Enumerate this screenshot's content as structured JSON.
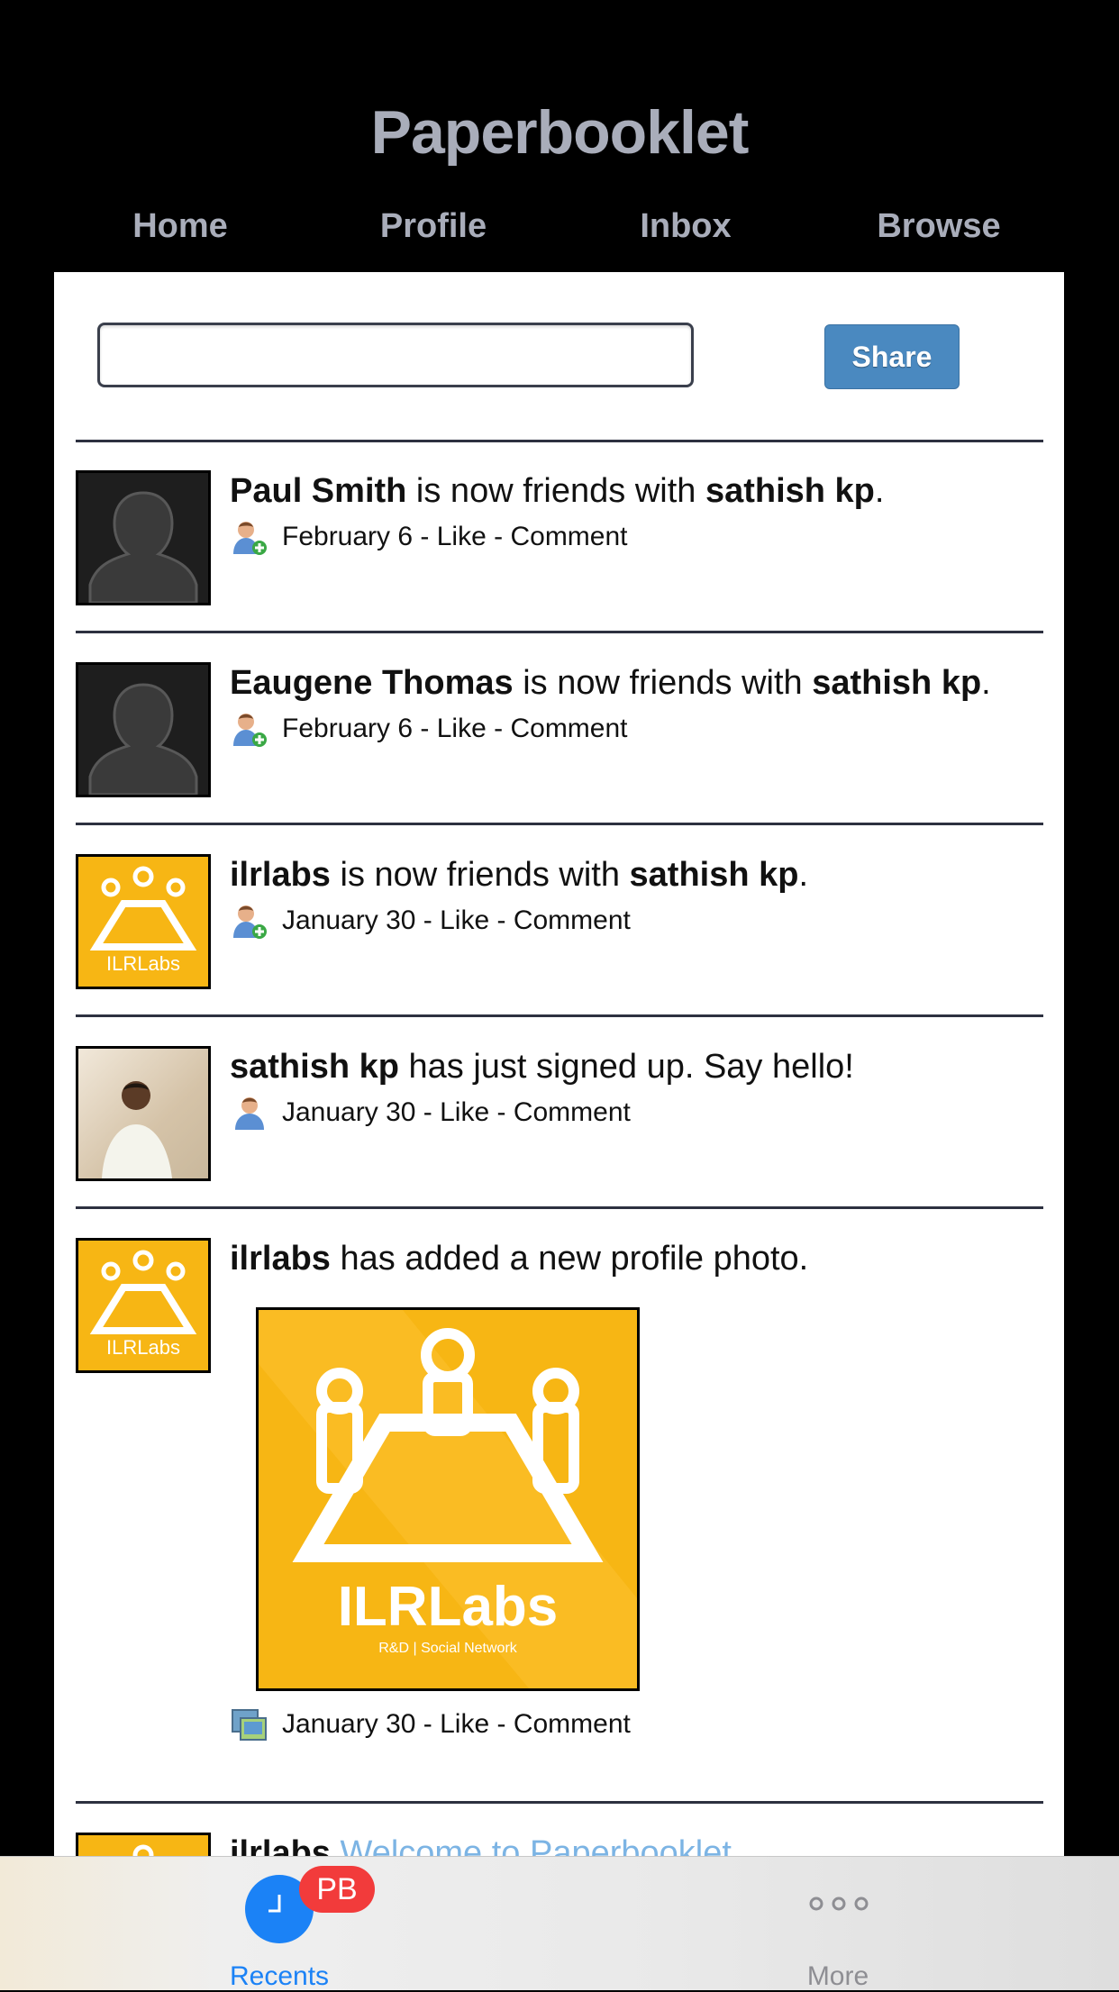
{
  "app": {
    "title": "Paperbooklet"
  },
  "nav": {
    "items": [
      "Home",
      "Profile",
      "Inbox",
      "Browse"
    ]
  },
  "composer": {
    "input_value": "",
    "share_label": "Share"
  },
  "feed": [
    {
      "actor": "Paul Smith",
      "text": " is now friends with ",
      "target": "sathish kp",
      "end": ".",
      "date": "February 6",
      "like": "Like",
      "comment": "Comment",
      "avatar": "silhouette",
      "icon": "add-friend-icon"
    },
    {
      "actor": "Eaugene Thomas",
      "text": " is now friends with ",
      "target": "sathish kp",
      "end": ".",
      "date": "February 6",
      "like": "Like",
      "comment": "Comment",
      "avatar": "silhouette",
      "icon": "add-friend-icon"
    },
    {
      "actor": "ilrlabs",
      "text": " is now friends with ",
      "target": "sathish kp",
      "end": ".",
      "date": "January 30",
      "like": "Like",
      "comment": "Comment",
      "avatar": "ilrlabs-logo",
      "icon": "add-friend-icon"
    },
    {
      "actor": "sathish kp",
      "text": " has just signed up. Say hello!",
      "date": "January 30",
      "like": "Like",
      "comment": "Comment",
      "avatar": "user-photo",
      "icon": "user-icon"
    },
    {
      "actor": "ilrlabs",
      "text": " has added a new profile photo.",
      "date": "January 30",
      "like": "Like",
      "comment": "Comment",
      "avatar": "ilrlabs-logo",
      "icon": "photos-icon",
      "photo_logo": "ILRLabs",
      "photo_sub": "R&D | Social Network"
    },
    {
      "actor": "ilrlabs",
      "link": "Welcome to Paperbooklet",
      "avatar": "ilrlabs-logo"
    }
  ],
  "meta_separator": " - ",
  "logo_small": {
    "name": "ILRLabs",
    "sub": "R&D | Social Network"
  },
  "tabbar": {
    "recents_label": "Recents",
    "recents_badge": "PB",
    "more_label": "More",
    "active_color": "#1b82f6",
    "inactive_color": "#8e8e93"
  }
}
